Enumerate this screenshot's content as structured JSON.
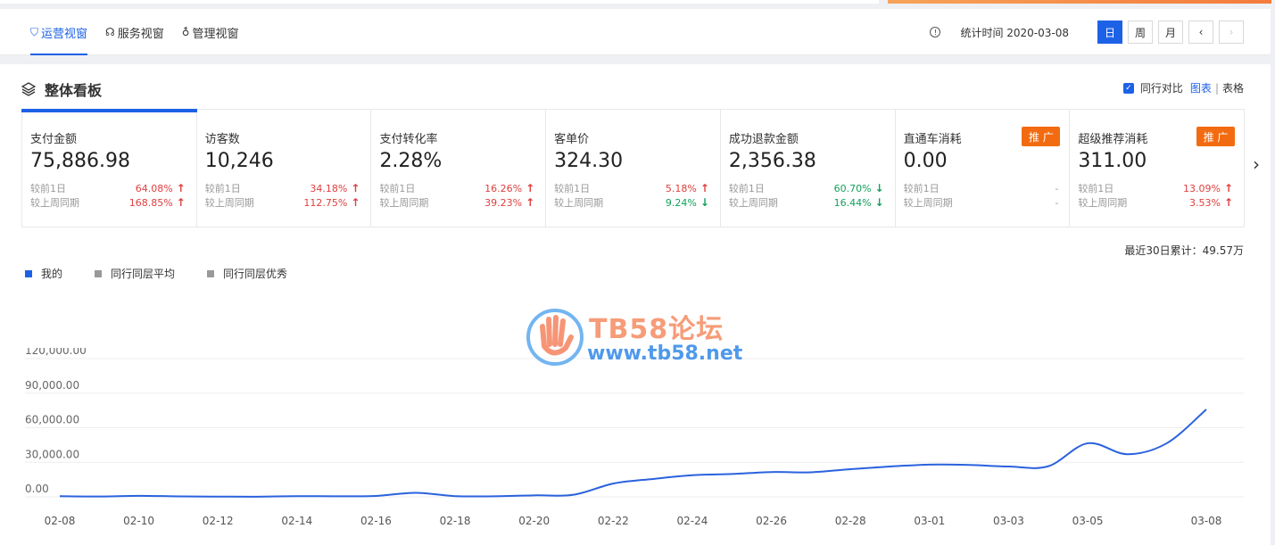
{
  "header": {
    "tabs": [
      {
        "label": "运营视窗",
        "icon": "shield-icon",
        "active": true
      },
      {
        "label": "服务视窗",
        "icon": "headset-icon",
        "active": false
      },
      {
        "label": "管理视窗",
        "icon": "medal-icon",
        "active": false
      }
    ],
    "stat_time": "统计时间 2020-03-08",
    "periods": [
      "日",
      "周",
      "月"
    ]
  },
  "panel": {
    "title": "整体看板",
    "compare_label": "同行对比",
    "view_chart": "图表",
    "view_table": "表格",
    "total_30d": "最近30日累计：49.57万"
  },
  "cards": [
    {
      "name": "支付金额",
      "value": "75,886.98",
      "c1_label": "较前1日",
      "c1_val": "64.08%",
      "c1_dir": "up",
      "c2_label": "较上周同期",
      "c2_val": "168.85%",
      "c2_dir": "up",
      "promo": ""
    },
    {
      "name": "访客数",
      "value": "10,246",
      "c1_label": "较前1日",
      "c1_val": "34.18%",
      "c1_dir": "up",
      "c2_label": "较上周同期",
      "c2_val": "112.75%",
      "c2_dir": "up",
      "promo": ""
    },
    {
      "name": "支付转化率",
      "value": "2.28%",
      "c1_label": "较前1日",
      "c1_val": "16.26%",
      "c1_dir": "up",
      "c2_label": "较上周同期",
      "c2_val": "39.23%",
      "c2_dir": "up",
      "promo": ""
    },
    {
      "name": "客单价",
      "value": "324.30",
      "c1_label": "较前1日",
      "c1_val": "5.18%",
      "c1_dir": "up",
      "c2_label": "较上周同期",
      "c2_val": "9.24%",
      "c2_dir": "down",
      "promo": ""
    },
    {
      "name": "成功退款金额",
      "value": "2,356.38",
      "c1_label": "较前1日",
      "c1_val": "60.70%",
      "c1_dir": "down",
      "c2_label": "较上周同期",
      "c2_val": "16.44%",
      "c2_dir": "down",
      "promo": ""
    },
    {
      "name": "直通车消耗",
      "value": "0.00",
      "c1_label": "较前1日",
      "c1_val": "-",
      "c1_dir": "none",
      "c2_label": "较上周同期",
      "c2_val": "-",
      "c2_dir": "none",
      "promo": "推 广"
    },
    {
      "name": "超级推荐消耗",
      "value": "311.00",
      "c1_label": "较前1日",
      "c1_val": "13.09%",
      "c1_dir": "up",
      "c2_label": "较上周同期",
      "c2_val": "3.53%",
      "c2_dir": "up",
      "promo": "推 广"
    }
  ],
  "watermark": {
    "line1": "TB58论坛",
    "line2": "www.tb58.net"
  },
  "colors": {
    "accent": "#1d61e6",
    "up": "#e03e3e",
    "down": "#12a15b",
    "promo": "#f36b10"
  },
  "chart_data": {
    "type": "line",
    "legend": [
      "我的",
      "同行同层平均",
      "同行同层优秀"
    ],
    "legend_colors": [
      "#1d61e6",
      "#999999",
      "#999999"
    ],
    "y_ticks": [
      "120,000.00",
      "90,000.00",
      "60,000.00",
      "30,000.00",
      "0.00"
    ],
    "ylim": [
      0,
      120000
    ],
    "x_ticks": [
      "02-08",
      "02-10",
      "02-12",
      "02-14",
      "02-16",
      "02-18",
      "02-20",
      "02-22",
      "02-24",
      "02-26",
      "02-28",
      "03-01",
      "03-03",
      "03-05",
      "03-08"
    ],
    "series": [
      {
        "name": "我的",
        "x": [
          "02-08",
          "02-09",
          "02-10",
          "02-11",
          "02-12",
          "02-13",
          "02-14",
          "02-15",
          "02-16",
          "02-17",
          "02-18",
          "02-19",
          "02-20",
          "02-21",
          "02-22",
          "02-23",
          "02-24",
          "02-25",
          "02-26",
          "02-27",
          "02-28",
          "02-29",
          "03-01",
          "03-02",
          "03-03",
          "03-04",
          "03-05",
          "03-06",
          "03-07",
          "03-08"
        ],
        "values": [
          600,
          300,
          900,
          400,
          200,
          100,
          600,
          500,
          800,
          3500,
          600,
          500,
          1300,
          1800,
          11500,
          15500,
          18800,
          19800,
          21500,
          21300,
          24000,
          26300,
          28000,
          27700,
          26300,
          26500,
          46500,
          37000,
          46500,
          75886.98
        ]
      }
    ]
  }
}
